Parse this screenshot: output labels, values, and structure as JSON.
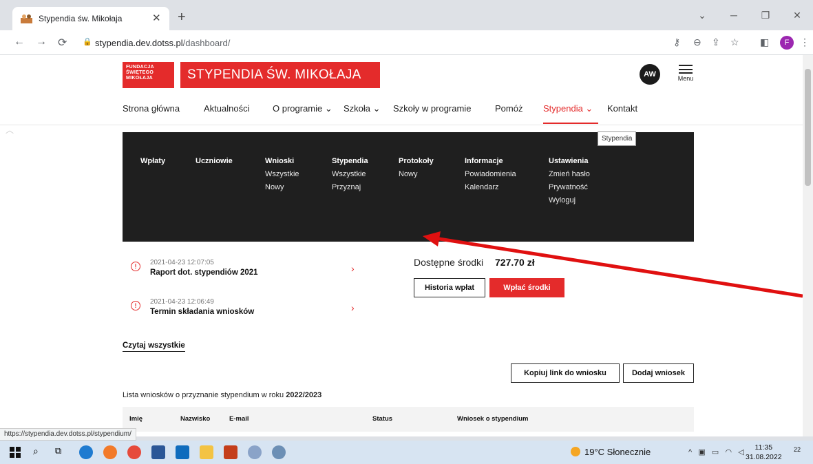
{
  "browser": {
    "tab_title": "Stypendia św. Mikołaja",
    "url_host": "stypendia.dev.dotss.pl",
    "url_path": "/dashboard/",
    "profile_initial": "F",
    "status_url": "https://stypendia.dev.dotss.pl/stypendium/"
  },
  "header": {
    "logo_text": [
      "FUNDACJA",
      "ŚWIĘTEGO",
      "MIKOŁAJA"
    ],
    "site_title": "STYPENDIA ŚW. MIKOŁAJA",
    "avatar_initials": "AW",
    "menu_label": "Menu",
    "accent_color": "#e42b2b"
  },
  "nav": {
    "items": [
      {
        "label": "Strona główna"
      },
      {
        "label": "Aktualności"
      },
      {
        "label": "O programie ⌄"
      },
      {
        "label": "Szkoła ⌄"
      },
      {
        "label": "Szkoły w programie"
      },
      {
        "label": "Pomóż"
      },
      {
        "label": "Stypendia ⌄"
      },
      {
        "label": "Kontakt"
      }
    ],
    "tooltip": "Stypendia"
  },
  "megamenu": {
    "columns": [
      {
        "head": "Wpłaty",
        "items": []
      },
      {
        "head": "Uczniowie",
        "items": []
      },
      {
        "head": "Wnioski",
        "items": [
          "Wszystkie",
          "Nowy"
        ]
      },
      {
        "head": "Stypendia",
        "items": [
          "Wszystkie",
          "Przyznaj"
        ]
      },
      {
        "head": "Protokoły",
        "items": [
          "Nowy"
        ]
      },
      {
        "head": "Informacje",
        "items": [
          "Powiadomienia",
          "Kalendarz"
        ]
      },
      {
        "head": "Ustawienia",
        "items": [
          "Zmień hasło",
          "Prywatność",
          "Wyloguj"
        ]
      }
    ]
  },
  "notifications": [
    {
      "date": "2021-04-23 12:07:05",
      "title": "Raport dot. stypendiów 2021"
    },
    {
      "date": "2021-04-23 12:06:49",
      "title": "Termin składania wniosków"
    }
  ],
  "funds": {
    "label": "Dostępne środki",
    "value": "727.70 zł",
    "history_btn": "Historia wpłat",
    "pay_btn": "Wpłać środki"
  },
  "read_all": "Czytaj wszystkie",
  "actions": {
    "copy_link": "Kopiuj link do wniosku",
    "add": "Dodaj wniosek"
  },
  "list": {
    "title_prefix": "Lista wniosków o przyznanie stypendium w roku ",
    "year": "2022/2023",
    "columns": [
      "Imię",
      "Nazwisko",
      "E-mail",
      "Status",
      "Wniosek o stypendium"
    ]
  },
  "taskbar": {
    "weather": "19°C Słonecznie",
    "time": "11:35",
    "date": "31.08.2022",
    "notif_count": "22"
  }
}
